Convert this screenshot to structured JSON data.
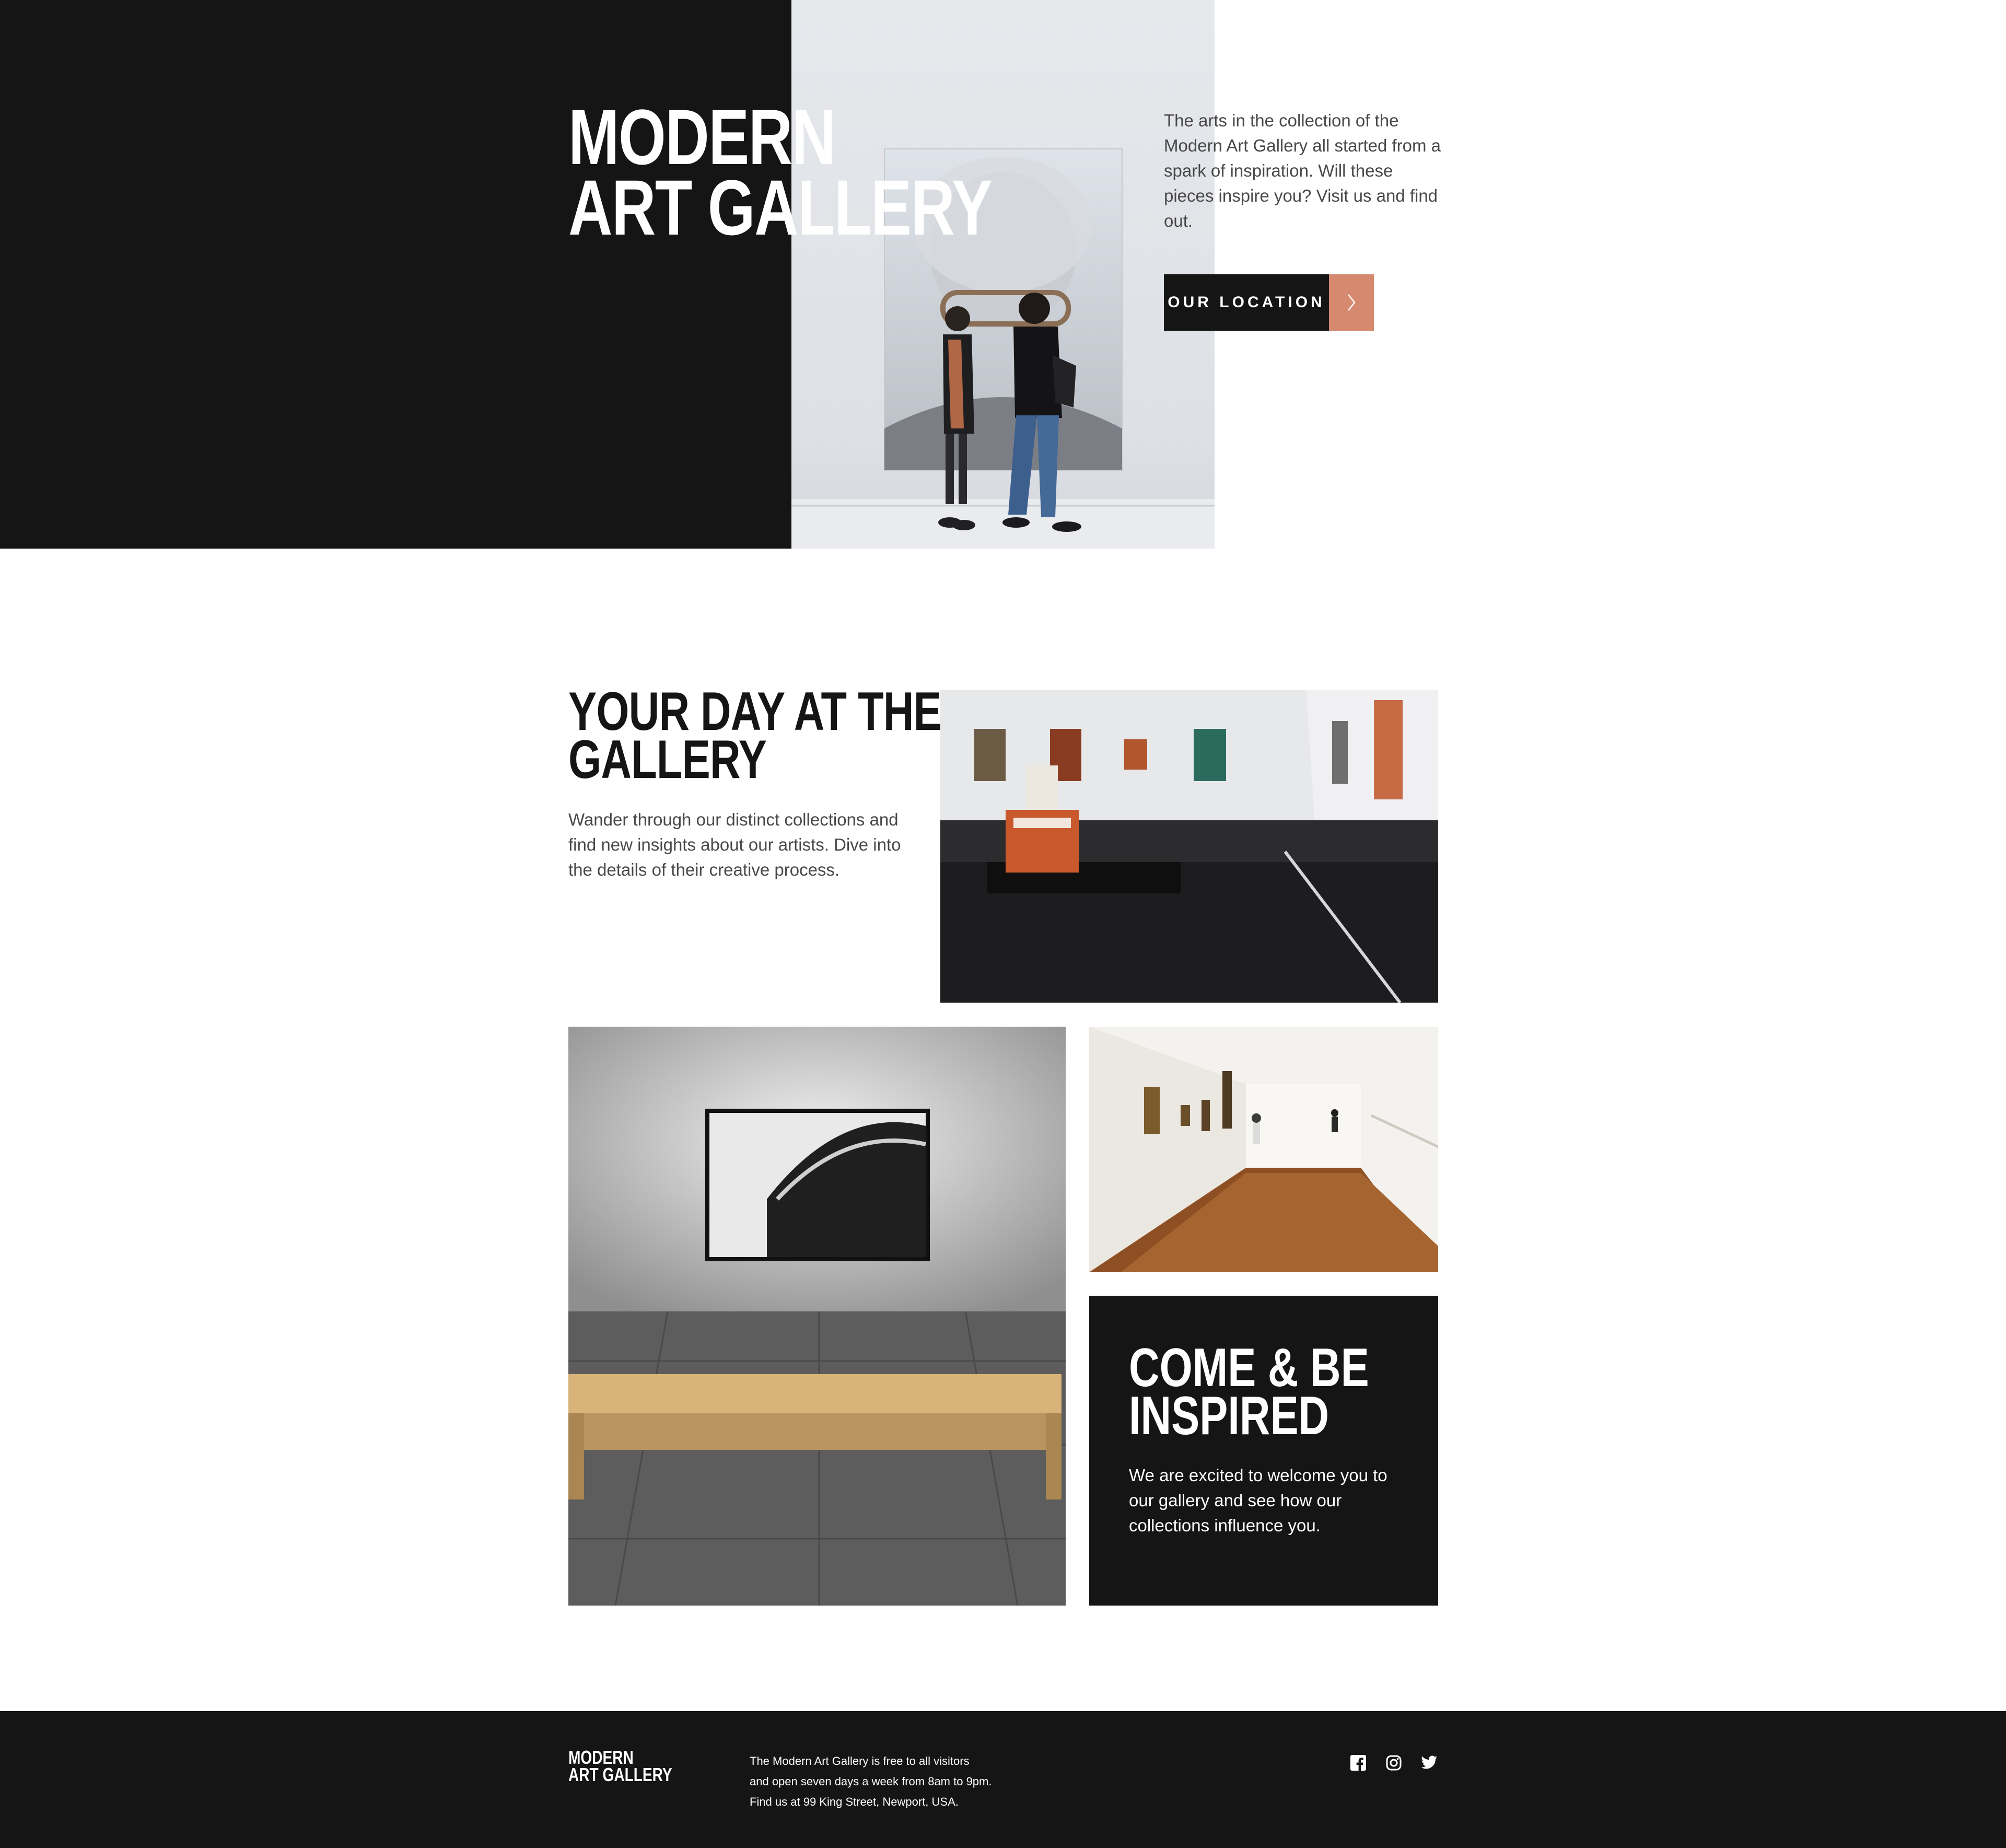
{
  "hero": {
    "title_line1": "MODERN",
    "title_line2": "ART GALLERY",
    "description": "The arts in the collection of the Modern Art Gallery all started from a spark of inspiration. Will these pieces inspire you? Visit us and find out.",
    "button_label": "OUR LOCATION",
    "arrow_icon": "chevron-right-icon"
  },
  "day": {
    "title_line1": "YOUR DAY AT THE",
    "title_line2": "GALLERY",
    "description": "Wander through our distinct collections and find new insights about our artists. Dive into the details of their creative process."
  },
  "inspired": {
    "title_line1": "COME & BE",
    "title_line2": "INSPIRED",
    "description": "We are excited to welcome you to our gallery and see how our collections influence you."
  },
  "footer": {
    "logo_line1": "MODERN",
    "logo_line2": "ART GALLERY",
    "info_line1": "The Modern Art Gallery is free to all visitors",
    "info_line2": "and open seven days a week from 8am to 9pm.",
    "info_line3": "Find us at 99 King Street, Newport, USA.",
    "social_icons": [
      "facebook-icon",
      "instagram-icon",
      "twitter-icon"
    ]
  },
  "colors": {
    "dark": "#151515",
    "accent": "#d5896f",
    "body_text": "#484848",
    "white": "#ffffff"
  }
}
